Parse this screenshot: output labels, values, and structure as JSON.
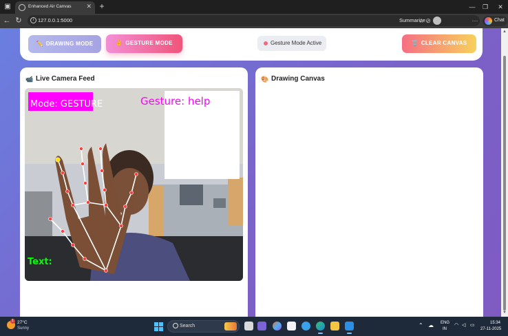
{
  "browser": {
    "tab_title": "Enhanced Air Canvas",
    "url": "127.0.0.1:5000",
    "summarize_label": "Summarize",
    "chat_label": "Chat"
  },
  "controls": {
    "drawing_mode_label": "DRAWING MODE",
    "drawing_mode_icon": "✏️",
    "gesture_mode_label": "GESTURE MODE",
    "gesture_mode_icon": "✌️",
    "status_text": "Gesture Mode Active",
    "clear_canvas_label": "CLEAR CANVAS",
    "clear_canvas_icon": "🗑️"
  },
  "camera_panel": {
    "title": "Live Camera Feed",
    "icon": "📹",
    "overlay_mode": "Mode: GESTURE",
    "overlay_gesture": "Gesture: help",
    "overlay_text": "Text:"
  },
  "canvas_panel": {
    "title": "Drawing Canvas",
    "icon": "🎨"
  },
  "colors": {
    "accent_pink": "#f0557a",
    "overlay_magenta": "#ff00ff",
    "overlay_green": "#00ff00",
    "landmark_red": "#ff3b3b"
  },
  "taskbar": {
    "weather_temp": "27°C",
    "weather_condition": "Sunny",
    "weather_badge": "1",
    "search_placeholder": "Search",
    "lang_top": "ENG",
    "lang_bottom": "IN",
    "time": "15:34",
    "date": "27-11-2025"
  }
}
